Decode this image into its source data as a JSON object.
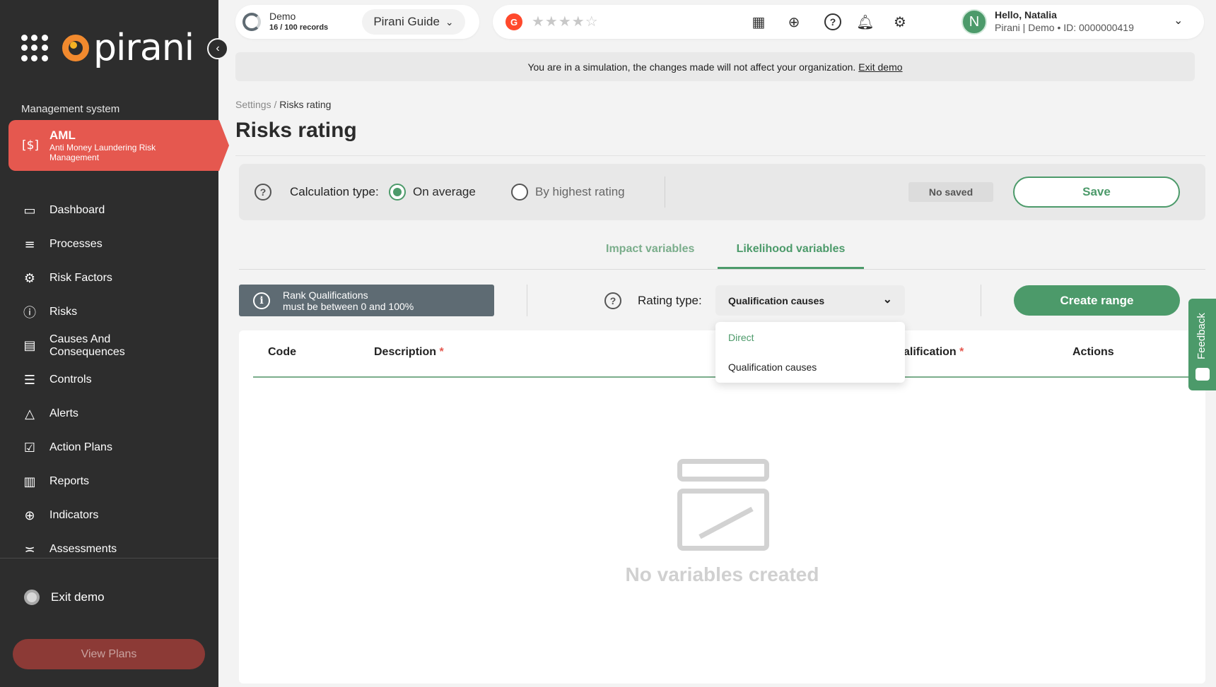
{
  "sidebar": {
    "logo_text": "pirani",
    "section_label": "Management system",
    "module": {
      "title": "AML",
      "subtitle": "Anti Money Laundering Risk Management"
    },
    "items": [
      {
        "label": "Dashboard",
        "icon": "monitor-icon"
      },
      {
        "label": "Processes",
        "icon": "list-icon"
      },
      {
        "label": "Risk Factors",
        "icon": "users-gear-icon"
      },
      {
        "label": "Risks",
        "icon": "alert-circle-icon"
      },
      {
        "label": "Causes And Consequences",
        "icon": "clipboard-icon"
      },
      {
        "label": "Controls",
        "icon": "sliders-icon"
      },
      {
        "label": "Alerts",
        "icon": "warning-triangle-icon"
      },
      {
        "label": "Action Plans",
        "icon": "checkbox-icon"
      },
      {
        "label": "Reports",
        "icon": "report-icon"
      },
      {
        "label": "Indicators",
        "icon": "crosshair-icon"
      },
      {
        "label": "Assessments",
        "icon": "assessment-icon"
      }
    ],
    "exit_demo": "Exit demo",
    "view_plans": "View Plans"
  },
  "topbar": {
    "demo_label": "Demo",
    "records": "16 / 100 records",
    "guide_label": "Pirani Guide",
    "g2_label": "G",
    "greeting": "Hello, Natalia",
    "user_sub": "Pirani | Demo • ID: 0000000419",
    "avatar_initial": "N"
  },
  "banner": {
    "text": "You are in a simulation, the changes made will not affect your organization.",
    "link": "Exit demo"
  },
  "breadcrumb": {
    "parent": "Settings /",
    "current": "Risks rating"
  },
  "page_title": "Risks rating",
  "calc": {
    "label": "Calculation type:",
    "options": [
      "On average",
      "By highest rating"
    ],
    "selected": "On average",
    "status": "No saved",
    "save": "Save"
  },
  "tabs": [
    {
      "label": "Impact variables",
      "active": false
    },
    {
      "label": "Likelihood variables",
      "active": true
    }
  ],
  "toolbar": {
    "info_line1": "Rank Qualifications",
    "info_line2": "must be between 0 and 100%",
    "rating_label": "Rating type:",
    "rating_value": "Qualification causes",
    "create": "Create range"
  },
  "dropdown": {
    "options": [
      "Direct",
      "Qualification causes"
    ]
  },
  "table": {
    "columns": [
      "Code",
      "Description",
      "alification",
      "Actions"
    ],
    "required_mark": "*",
    "empty": "No variables created"
  },
  "feedback": "Feedback",
  "colors": {
    "accent": "#4c9a6a",
    "module": "#e5584f",
    "sidebar": "#2d2d2d"
  }
}
